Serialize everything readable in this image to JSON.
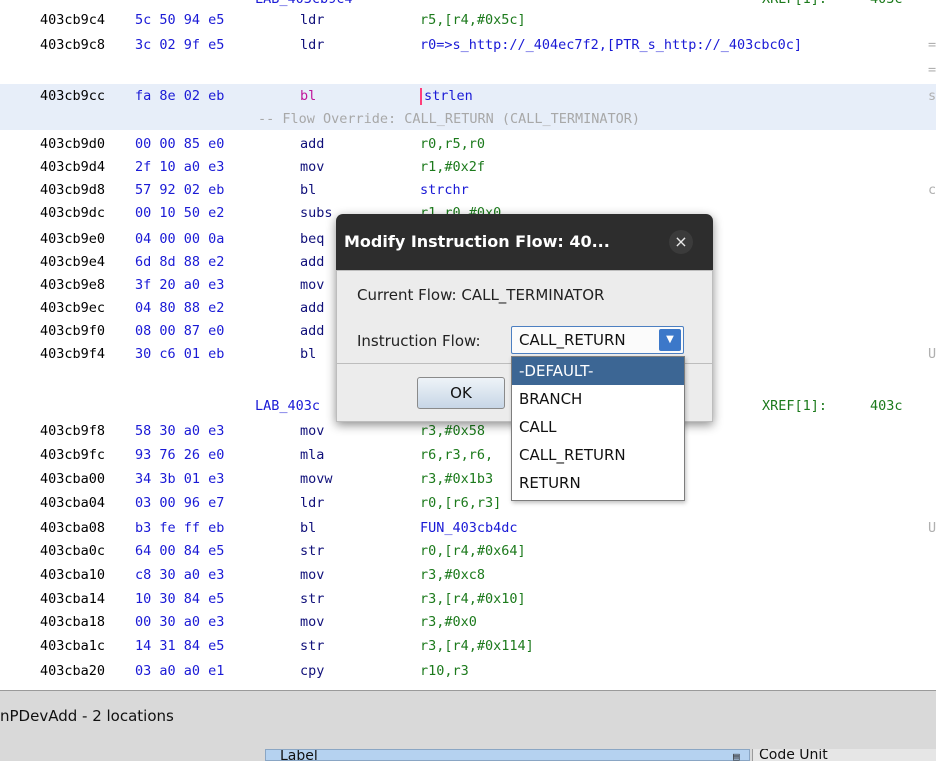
{
  "listing": {
    "top_label": {
      "label": "LAB_403cb9c4",
      "xref": "XREF[1]:",
      "xref_addr": "403c"
    },
    "rows": [
      {
        "addr": "403cb9c4",
        "bytes": "5c 50 94 e5",
        "mn": "ldr",
        "ops": "r5,[r4,#0x5c]",
        "gutter": ""
      },
      {
        "addr": "403cb9c8",
        "bytes": "3c 02 9f e5",
        "mn": "ldr",
        "ops": "r0=>s_http://_404ec7f2,[PTR_s_http://_403cbc0c]",
        "gutter": "="
      },
      {
        "addr": "",
        "bytes": "",
        "mn": "",
        "ops": "",
        "gutter": "="
      },
      {
        "addr": "403cb9cc",
        "bytes": "fa 8e 02 eb",
        "mn": "bl",
        "ops": "strlen",
        "gutter": "s"
      },
      {
        "addr": "403cb9d0",
        "bytes": "00 00 85 e0",
        "mn": "add",
        "ops": "r0,r5,r0",
        "gutter": ""
      },
      {
        "addr": "403cb9d4",
        "bytes": "2f 10 a0 e3",
        "mn": "mov",
        "ops": "r1,#0x2f",
        "gutter": ""
      },
      {
        "addr": "403cb9d8",
        "bytes": "57 92 02 eb",
        "mn": "bl",
        "ops": "strchr",
        "gutter": "c"
      },
      {
        "addr": "403cb9dc",
        "bytes": "00 10 50 e2",
        "mn": "subs",
        "ops": "r1,r0,#0x0",
        "gutter": ""
      },
      {
        "addr": "403cb9e0",
        "bytes": "04 00 00 0a",
        "mn": "beq",
        "ops": "",
        "gutter": ""
      },
      {
        "addr": "403cb9e4",
        "bytes": "6d 8d 88 e2",
        "mn": "add",
        "ops": "",
        "gutter": ""
      },
      {
        "addr": "403cb9e8",
        "bytes": "3f 20 a0 e3",
        "mn": "mov",
        "ops": "",
        "gutter": ""
      },
      {
        "addr": "403cb9ec",
        "bytes": "04 80 88 e2",
        "mn": "add",
        "ops": "",
        "gutter": ""
      },
      {
        "addr": "403cb9f0",
        "bytes": "08 00 87 e0",
        "mn": "add",
        "ops": "",
        "gutter": ""
      },
      {
        "addr": "403cb9f4",
        "bytes": "30 c6 01 eb",
        "mn": "bl",
        "ops": "",
        "gutter": "U"
      },
      {
        "addr": "403cb9f8",
        "bytes": "58 30 a0 e3",
        "mn": "mov",
        "ops": "r3,#0x58",
        "gutter": ""
      },
      {
        "addr": "403cb9fc",
        "bytes": "93 76 26 e0",
        "mn": "mla",
        "ops": "r6,r3,r6,",
        "gutter": ""
      },
      {
        "addr": "403cba00",
        "bytes": "34 3b 01 e3",
        "mn": "movw",
        "ops": "r3,#0x1b3",
        "gutter": ""
      },
      {
        "addr": "403cba04",
        "bytes": "03 00 96 e7",
        "mn": "ldr",
        "ops": "r0,[r6,r3]",
        "gutter": ""
      },
      {
        "addr": "403cba08",
        "bytes": "b3 fe ff eb",
        "mn": "bl",
        "ops": "FUN_403cb4dc",
        "gutter": "U"
      },
      {
        "addr": "403cba0c",
        "bytes": "64 00 84 e5",
        "mn": "str",
        "ops": "r0,[r4,#0x64]",
        "gutter": ""
      },
      {
        "addr": "403cba10",
        "bytes": "c8 30 a0 e3",
        "mn": "mov",
        "ops": "r3,#0xc8",
        "gutter": ""
      },
      {
        "addr": "403cba14",
        "bytes": "10 30 84 e5",
        "mn": "str",
        "ops": "r3,[r4,#0x10]",
        "gutter": ""
      },
      {
        "addr": "403cba18",
        "bytes": "00 30 a0 e3",
        "mn": "mov",
        "ops": "r3,#0x0",
        "gutter": ""
      },
      {
        "addr": "403cba1c",
        "bytes": "14 31 84 e5",
        "mn": "str",
        "ops": "r3,[r4,#0x114]",
        "gutter": ""
      },
      {
        "addr": "403cba20",
        "bytes": "03 a0 a0 e1",
        "mn": "cpy",
        "ops": "r10,r3",
        "gutter": ""
      }
    ],
    "flow_override": "-- Flow Override: CALL_RETURN (CALL_TERMINATOR)",
    "mid_label": {
      "label": "LAB_403c",
      "xref": "XREF[1]:",
      "xref_addr": "403c"
    }
  },
  "bottom_panel": {
    "title": "nPDevAdd - 2 locations",
    "col_label": "Label",
    "col_code_unit": "Code Unit"
  },
  "dialog": {
    "title": "Modify Instruction Flow: 40...",
    "close_glyph": "×",
    "current_flow": "Current Flow: CALL_TERMINATOR",
    "flow_label": "Instruction Flow:",
    "selected_value": "CALL_RETURN",
    "ok_label": "OK",
    "options": [
      "-DEFAULT-",
      "BRANCH",
      "CALL",
      "CALL_RETURN",
      "RETURN"
    ],
    "highlighted_option": "-DEFAULT-"
  },
  "colors": {
    "highlight_row": "#e7eef9",
    "dialog_titlebar": "#2d2d2d",
    "dropdown_selected": "#3c6694",
    "address_blue": "#1a1ad6",
    "operand_green": "#1c7a1c"
  }
}
